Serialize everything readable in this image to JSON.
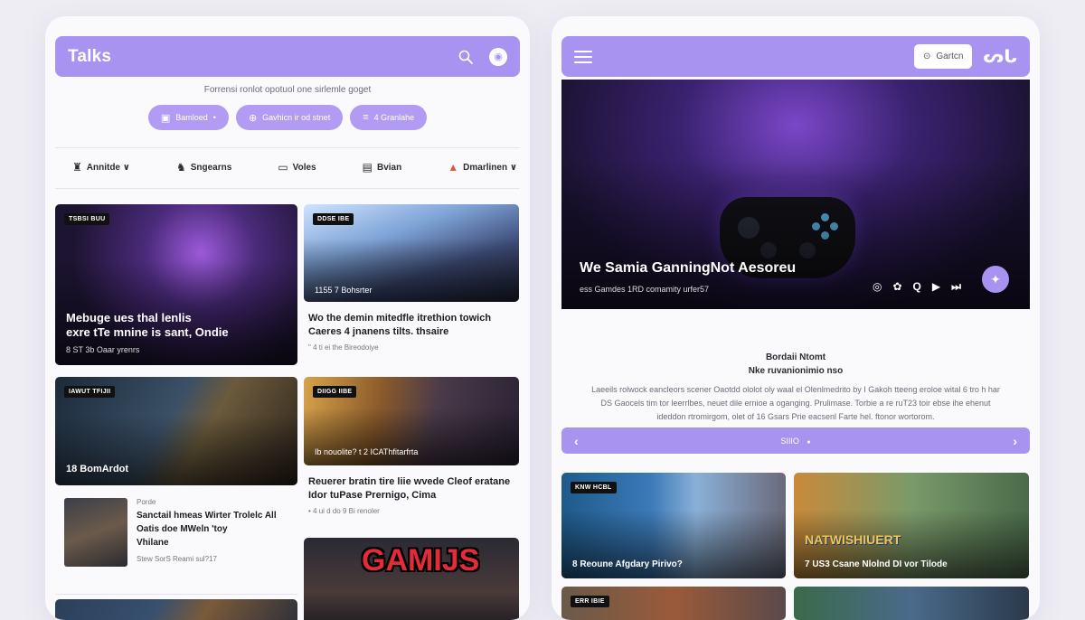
{
  "left": {
    "brand": "Talks",
    "tagline": "Forrensi ronlot opotuol one sirlemle goget",
    "pills": [
      {
        "icon": "▣",
        "label": "Bamloed",
        "suffix": "•"
      },
      {
        "icon": "⊕",
        "label": "Gavhicn ir od stnet"
      },
      {
        "icon": "≡",
        "label": "4 Granlahe"
      }
    ],
    "nav": [
      {
        "icon": "♜",
        "label": "Annitde ∨"
      },
      {
        "icon": "♞",
        "label": "Sngearns"
      },
      {
        "icon": "▭",
        "label": "Voles"
      },
      {
        "icon": "▤",
        "label": "Bvian"
      },
      {
        "icon": "▲",
        "label": "Dmarlinen ∨"
      }
    ],
    "cards": {
      "c1": {
        "tag": "TSBSI BUU",
        "title_line1": "Mebuge ues thal lenlis",
        "title_line2": "exre tTe mnine is sant, Ondie",
        "meta": "8 ST 3b Oaar yrenrs"
      },
      "c2": {
        "tag": "DDSE IBE",
        "overlay": "1155 7 Bohsrter",
        "title_line1": "Wo the demin mitedfle itrethion towich",
        "title_line2": "Caeres 4 jnanens tilts. thsaire",
        "meta": "\" 4 ti ei the Bireodoiye"
      },
      "c3": {
        "tag": "IAWUT TFIJII",
        "overlay": "18 BomArdot"
      },
      "c4": {
        "tag": "DIIGG IIBE",
        "overlay": "Ib nouolite? t 2 ICAThfitarfrta",
        "title_line1": "Reuerer bratin tire liie wvede Cleof eratane",
        "title_line2": "Idor tuPase Prernigo, Cima",
        "meta": "• 4 ui d do 9 Bi renoler"
      },
      "small": {
        "label": "Porde",
        "title_line1": "Sanctail hmeas Wirter Trolelc All",
        "title_line2": "Oatis doe MWeln 'toy",
        "title_line3": "Vhilane",
        "meta": "Stew SorS Reami sul?17"
      },
      "c6": {
        "logo": "GAMIJS"
      }
    }
  },
  "right": {
    "cta_label": "Gartcn",
    "logo_mark": "ᔕᒐ",
    "hero": {
      "title": "We Samia GanningNot Aesoreu",
      "subtitle": "ess Gamdes 1RD comamity urfer57",
      "controls": [
        "◎",
        "✿",
        "Q",
        "▶",
        "⏭"
      ]
    },
    "article": {
      "title_line1": "Bordaii Ntomt",
      "title_line2": "Nke ruvanionimio nso",
      "body_line1": "Laeeils rolwock eancleors scener Oaotdd ololot oly waal el Olenlmedrito by I Gakoh tteeng eroloe wital 6 tro h har",
      "body_line2": "DS Gaocels tim tor leerrlbes, neuet dile ernioe a oganging. Prulimase. Torbie a re ruT23 toir ebse ihe ehenut",
      "body_line3": "ideddon rtromirgom, olet of 16 Gsars Prie eacsenl Farte hel. ftonor wortorom."
    },
    "pager": {
      "prev": "‹",
      "label": "SIIIO",
      "dot": "●",
      "next": "›"
    },
    "cards": {
      "g1": {
        "tag": "KNW HCBL",
        "overlay": "8 Reoune Afgdary Pirivo?"
      },
      "g2": {
        "tag": "",
        "title_art": "NATWISHIUERT",
        "overlay": "7 US3 Csane Nlolnd DI vor Tilode"
      },
      "g3": {
        "tag": "ERR IBIE"
      }
    }
  }
}
